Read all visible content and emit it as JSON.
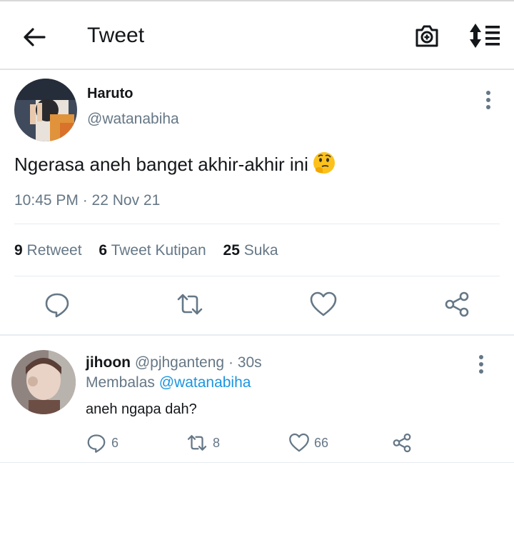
{
  "header": {
    "title": "Tweet"
  },
  "tweet": {
    "name": "Haruto",
    "handle": "@watanabiha",
    "text": "Ngerasa aneh banget akhir-akhir ini",
    "emoji": "thinking-face",
    "timestamp": "10:45 PM · 22 Nov 21",
    "stats": {
      "retweets_count": "9",
      "retweets_label": "Retweet",
      "quotes_count": "6",
      "quotes_label": "Tweet Kutipan",
      "likes_count": "25",
      "likes_label": "Suka"
    }
  },
  "reply": {
    "name": "jihoon",
    "handle": "@pjhganteng",
    "time": "· 30s",
    "replying_label": "Membalas",
    "replying_to": "@watanabiha",
    "text": "aneh ngapa dah?",
    "reply_count": "6",
    "retweet_count": "8",
    "like_count": "66"
  },
  "icons": [
    "back-arrow-icon",
    "camera-icon",
    "sort-icon",
    "more-vertical-icon",
    "reply-icon",
    "retweet-icon",
    "heart-icon",
    "share-icon",
    "thinking-face-emoji"
  ],
  "colors": {
    "text": "#14171a",
    "secondary": "#657786",
    "link": "#1b95e0",
    "icon": "#657786",
    "divider": "#e6ecf0"
  }
}
